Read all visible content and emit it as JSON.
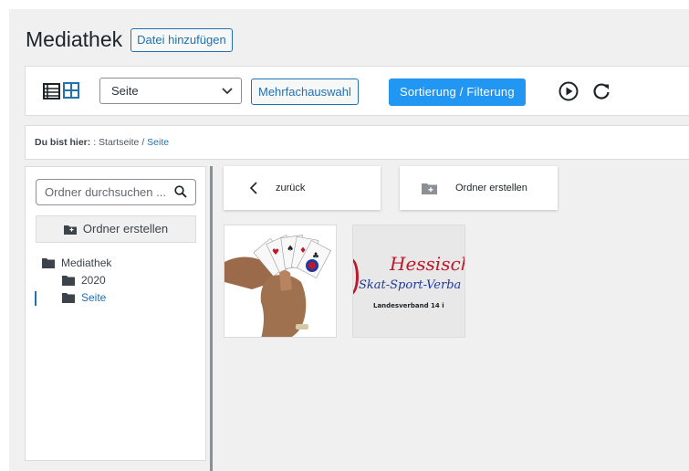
{
  "header": {
    "title": "Mediathek",
    "add_button": "Datei hinzufügen"
  },
  "toolbar": {
    "select_value": "Seite",
    "multi_select": "Mehrfachauswahl",
    "sort_filter": "Sortierung / Filterung",
    "icons": [
      "list-view-icon",
      "grid-view-icon",
      "play-circle-icon",
      "refresh-icon"
    ],
    "accent_color": "#2196f3",
    "link_color": "#2271b1"
  },
  "breadcrumb": {
    "label": "Du bist hier:",
    "separator": ":",
    "home": "Startseite",
    "slash": "/",
    "current": "Seite"
  },
  "sidebar": {
    "search_placeholder": "Ordner durchsuchen ...",
    "create_button": "Ordner erstellen",
    "tree": {
      "root": "Mediathek",
      "children": [
        "2020",
        "Seite"
      ],
      "active": "Seite"
    }
  },
  "main": {
    "back_label": "zurück",
    "create_folder_label": "Ordner erstellen",
    "logo": {
      "line1": "Hessisch",
      "line2": "Skat-Sport-Verba",
      "line3": "Landesverband 14 i"
    }
  }
}
